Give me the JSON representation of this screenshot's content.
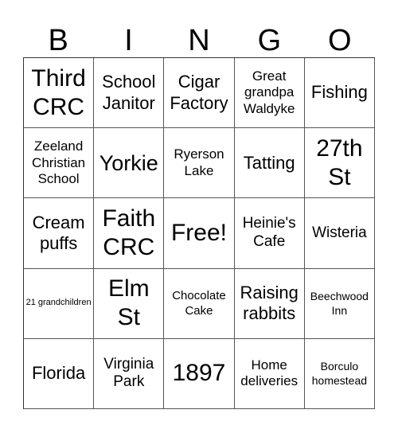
{
  "card": {
    "header": [
      "B",
      "I",
      "N",
      "G",
      "O"
    ],
    "rows": [
      [
        "Third CRC",
        "School Janitor",
        "Cigar Factory",
        "Great grandpa Waldyke",
        "Fishing"
      ],
      [
        "Zeeland Christian School",
        "Yorkie",
        "Ryerson Lake",
        "Tatting",
        "27th St"
      ],
      [
        "Cream puffs",
        "Faith CRC",
        "Free!",
        "Heinie's Cafe",
        "Wisteria"
      ],
      [
        "21 grandchildren",
        "Elm St",
        "Chocolate Cake",
        "Raising rabbits",
        "Beechwood Inn"
      ],
      [
        "Florida",
        "Virginia Park",
        "1897",
        "Home deliveries",
        "Borculo homestead"
      ]
    ],
    "free_space": "Free!",
    "colors": {
      "text": "#000000",
      "grid_line": "#555555",
      "background": "#ffffff"
    }
  }
}
